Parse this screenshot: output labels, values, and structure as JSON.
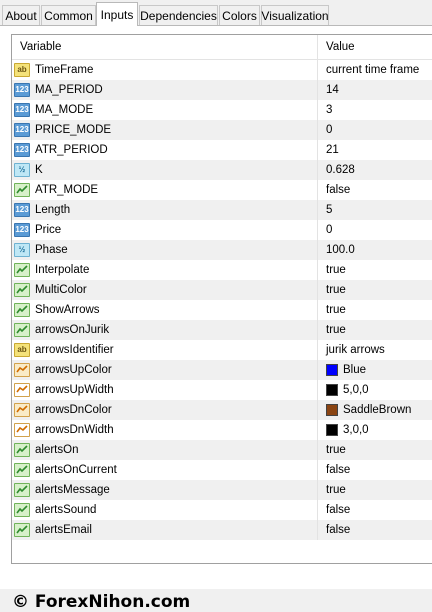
{
  "tabs": [
    "About",
    "Common",
    "Inputs",
    "Dependencies",
    "Colors",
    "Visualization"
  ],
  "active_tab": "Inputs",
  "grid": {
    "header": {
      "variable": "Variable",
      "value": "Value"
    },
    "rows": [
      {
        "icon": "string-icon",
        "name": "TimeFrame",
        "value": "current time frame"
      },
      {
        "icon": "integer-icon",
        "name": "MA_PERIOD",
        "value": "14"
      },
      {
        "icon": "integer-icon",
        "name": "MA_MODE",
        "value": "3"
      },
      {
        "icon": "integer-icon",
        "name": "PRICE_MODE",
        "value": "0"
      },
      {
        "icon": "integer-icon",
        "name": "ATR_PERIOD",
        "value": "21"
      },
      {
        "icon": "double-icon",
        "name": "K",
        "value": "0.628"
      },
      {
        "icon": "boolean-icon",
        "name": "ATR_MODE",
        "value": "false"
      },
      {
        "icon": "integer-icon",
        "name": "Length",
        "value": "5"
      },
      {
        "icon": "integer-icon",
        "name": "Price",
        "value": "0"
      },
      {
        "icon": "double-icon",
        "name": "Phase",
        "value": "100.0"
      },
      {
        "icon": "boolean-icon",
        "name": "Interpolate",
        "value": "true"
      },
      {
        "icon": "boolean-icon",
        "name": "MultiColor",
        "value": "true"
      },
      {
        "icon": "boolean-icon",
        "name": "ShowArrows",
        "value": "true"
      },
      {
        "icon": "boolean-icon",
        "name": "arrowsOnJurik",
        "value": "true"
      },
      {
        "icon": "string-icon",
        "name": "arrowsIdentifier",
        "value": "jurik arrows"
      },
      {
        "icon": "color-icon",
        "name": "arrowsUpColor",
        "value": "Blue",
        "swatch": "#0000ff"
      },
      {
        "icon": "width-icon",
        "name": "arrowsUpWidth",
        "value": "5,0,0",
        "swatch": "#000000"
      },
      {
        "icon": "color-icon",
        "name": "arrowsDnColor",
        "value": "SaddleBrown",
        "swatch": "#8b4513"
      },
      {
        "icon": "width-icon",
        "name": "arrowsDnWidth",
        "value": "3,0,0",
        "swatch": "#000000"
      },
      {
        "icon": "boolean-icon",
        "name": "alertsOn",
        "value": "true"
      },
      {
        "icon": "boolean-icon",
        "name": "alertsOnCurrent",
        "value": "false"
      },
      {
        "icon": "boolean-icon",
        "name": "alertsMessage",
        "value": "true"
      },
      {
        "icon": "boolean-icon",
        "name": "alertsSound",
        "value": "false"
      },
      {
        "icon": "boolean-icon",
        "name": "alertsEmail",
        "value": "false"
      }
    ]
  },
  "icon_labels": {
    "string": "ab",
    "integer": "123",
    "double": "½"
  },
  "footer": "© ForexNihon.com"
}
